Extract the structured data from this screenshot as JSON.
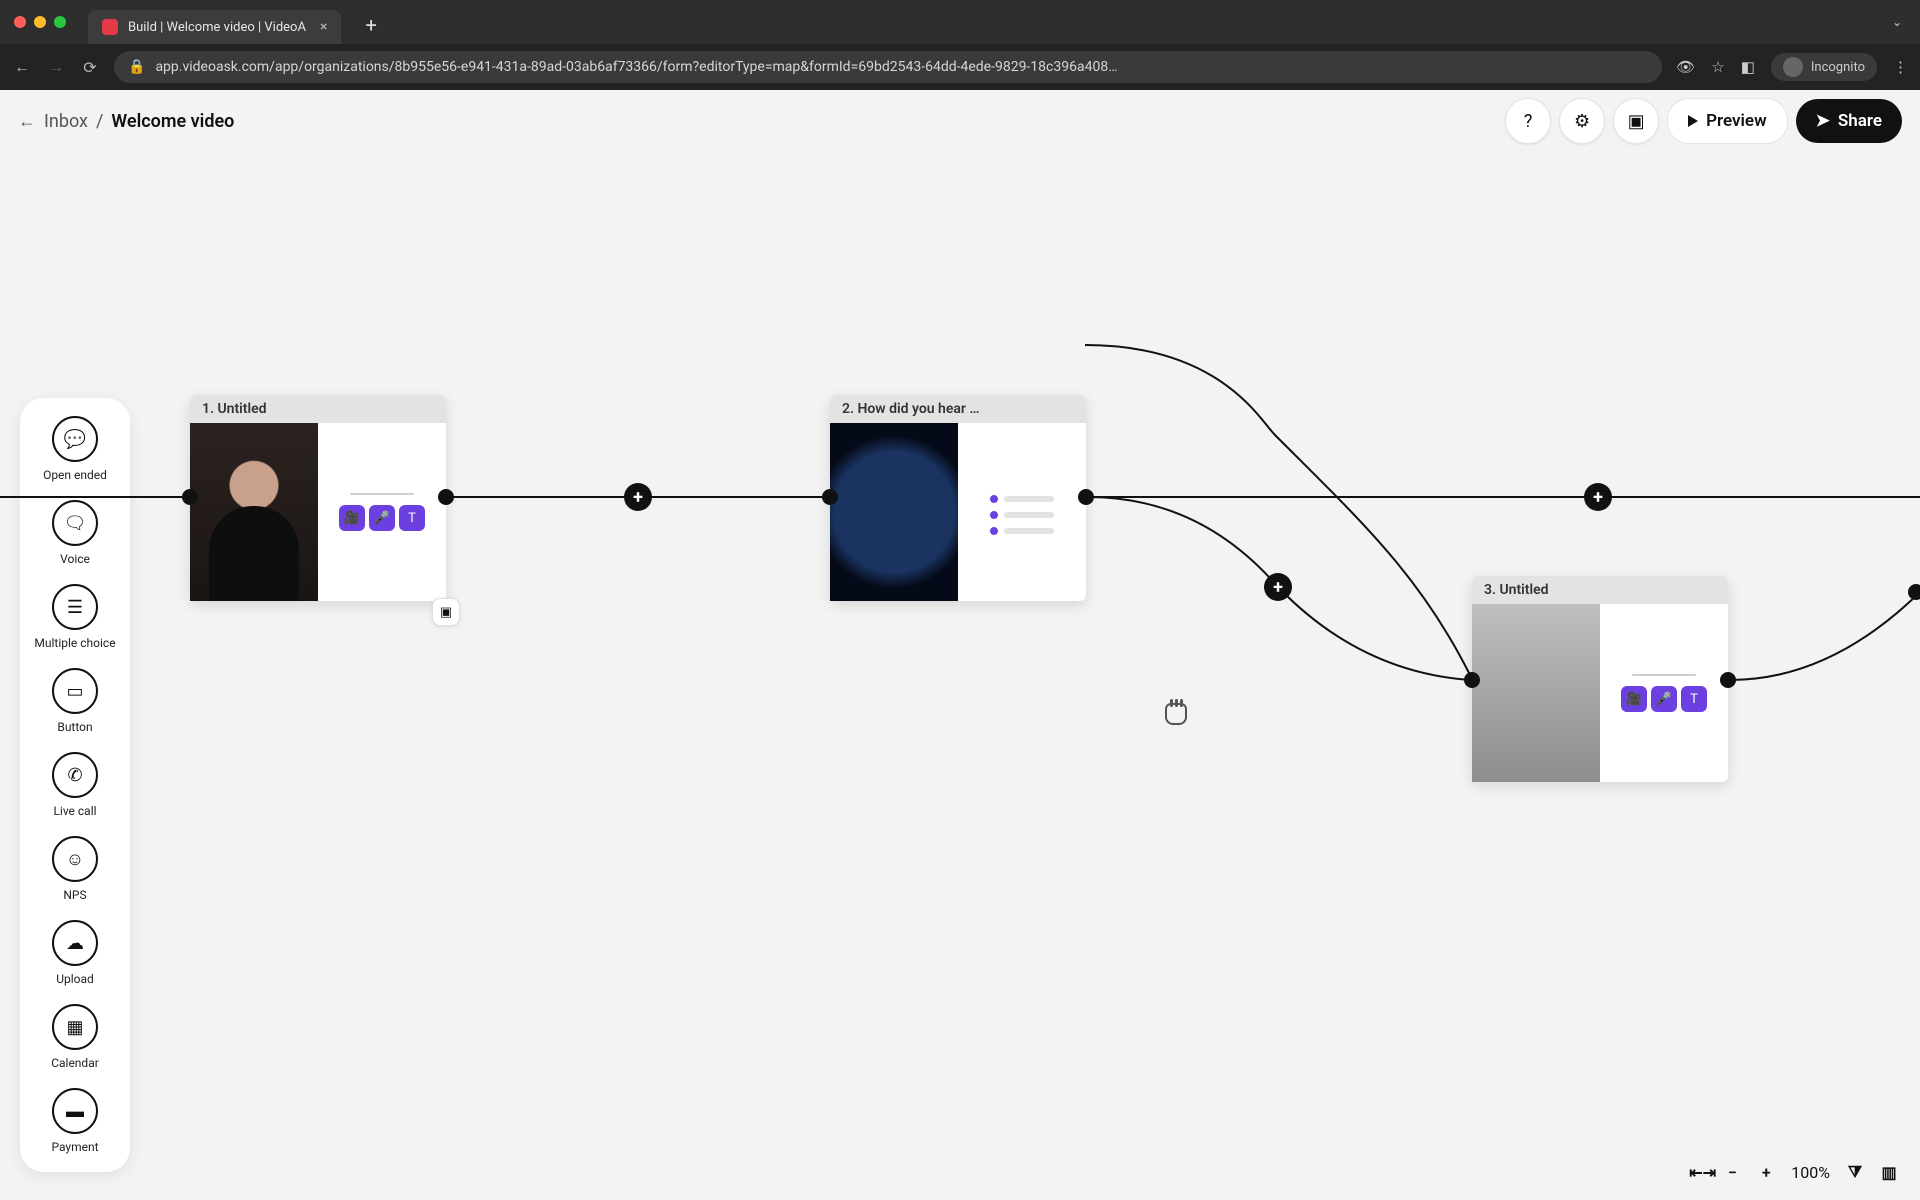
{
  "browser": {
    "tab_title": "Build | Welcome video | VideoA",
    "url": "app.videoask.com/app/organizations/8b955e56-e941-431a-89ad-03ab6af73366/form?editorType=map&formId=69bd2543-64dd-4ede-9829-18c396a408…",
    "incognito_label": "Incognito"
  },
  "header": {
    "back_label": "Inbox",
    "separator": "/",
    "title": "Welcome video",
    "preview_label": "Preview",
    "share_label": "Share"
  },
  "palette": {
    "items": [
      {
        "label": "Open ended"
      },
      {
        "label": "Voice"
      },
      {
        "label": "Multiple choice"
      },
      {
        "label": "Button"
      },
      {
        "label": "Live call"
      },
      {
        "label": "NPS"
      },
      {
        "label": "Upload"
      },
      {
        "label": "Calendar"
      },
      {
        "label": "Payment"
      }
    ]
  },
  "nodes": {
    "n1": {
      "title": "1. Untitled"
    },
    "n2": {
      "title": "2. How did you hear …"
    },
    "n3": {
      "title": "3. Untitled"
    }
  },
  "zoom": {
    "percent": "100%"
  },
  "colors": {
    "accent": "#6b3fe0",
    "node_header": "#e3e3e3"
  }
}
